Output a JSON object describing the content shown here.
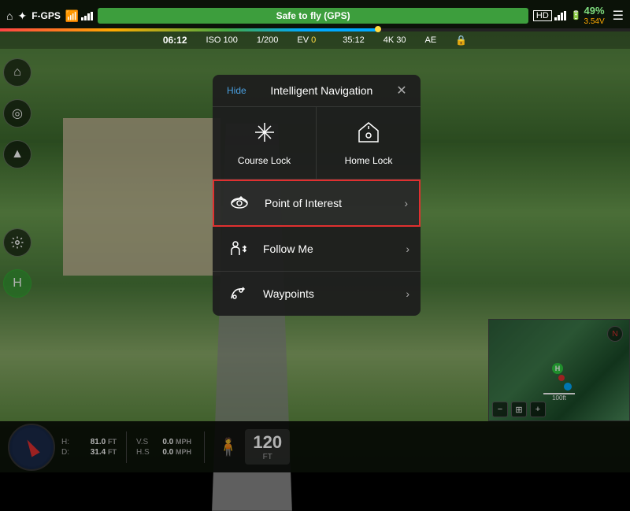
{
  "topbar": {
    "home_icon": "⌂",
    "drone_icon": "✦",
    "gps_label": "F-GPS",
    "signal_icon": "📶",
    "safe_to_fly": "Safe to fly (GPS)",
    "hd_label": "HD",
    "battery_percent": "49%",
    "battery_voltage": "3.54V",
    "menu_icon": "☰"
  },
  "timer": {
    "time": "06:12",
    "iso": "ISO 100",
    "shutter": "1/200",
    "ev_label": "EV",
    "ev_value": "0",
    "storage": "35:12",
    "resolution": "4K 30",
    "ae_label": "AE"
  },
  "panel": {
    "hide_label": "Hide",
    "title": "Intelligent Navigation",
    "close_icon": "✕",
    "features": [
      {
        "label": "Course Lock",
        "icon": "✛"
      },
      {
        "label": "Home Lock",
        "icon": "⊙"
      }
    ],
    "menu_items": [
      {
        "id": "poi",
        "label": "Point of Interest",
        "icon": "◎",
        "highlighted": true
      },
      {
        "id": "follow",
        "label": "Follow Me",
        "icon": "👤"
      },
      {
        "id": "waypoints",
        "label": "Waypoints",
        "icon": "↺"
      }
    ],
    "chevron": "›"
  },
  "bottom": {
    "h_label": "H:",
    "h_value": "81.0",
    "h_unit": "FT",
    "d_label": "D:",
    "d_value": "31.4",
    "d_unit": "FT",
    "vs_label": "V.S",
    "vs_value": "0.0",
    "vs_unit": "MPH",
    "hs_label": "H.S",
    "hs_value": "0.0",
    "hs_unit": "MPH",
    "altitude": "120",
    "altitude_unit": "FT"
  },
  "sidebar": {
    "icons": [
      "⌂",
      "◎",
      "▲",
      "☰",
      "H"
    ]
  }
}
